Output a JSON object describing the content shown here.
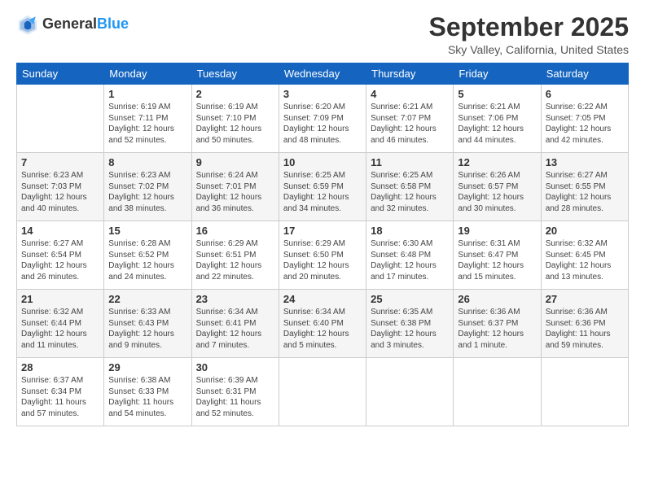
{
  "header": {
    "logo_general": "General",
    "logo_blue": "Blue",
    "title": "September 2025",
    "subtitle": "Sky Valley, California, United States"
  },
  "days_of_week": [
    "Sunday",
    "Monday",
    "Tuesday",
    "Wednesday",
    "Thursday",
    "Friday",
    "Saturday"
  ],
  "weeks": [
    [
      {
        "day": "",
        "info": ""
      },
      {
        "day": "1",
        "info": "Sunrise: 6:19 AM\nSunset: 7:11 PM\nDaylight: 12 hours\nand 52 minutes."
      },
      {
        "day": "2",
        "info": "Sunrise: 6:19 AM\nSunset: 7:10 PM\nDaylight: 12 hours\nand 50 minutes."
      },
      {
        "day": "3",
        "info": "Sunrise: 6:20 AM\nSunset: 7:09 PM\nDaylight: 12 hours\nand 48 minutes."
      },
      {
        "day": "4",
        "info": "Sunrise: 6:21 AM\nSunset: 7:07 PM\nDaylight: 12 hours\nand 46 minutes."
      },
      {
        "day": "5",
        "info": "Sunrise: 6:21 AM\nSunset: 7:06 PM\nDaylight: 12 hours\nand 44 minutes."
      },
      {
        "day": "6",
        "info": "Sunrise: 6:22 AM\nSunset: 7:05 PM\nDaylight: 12 hours\nand 42 minutes."
      }
    ],
    [
      {
        "day": "7",
        "info": "Sunrise: 6:23 AM\nSunset: 7:03 PM\nDaylight: 12 hours\nand 40 minutes."
      },
      {
        "day": "8",
        "info": "Sunrise: 6:23 AM\nSunset: 7:02 PM\nDaylight: 12 hours\nand 38 minutes."
      },
      {
        "day": "9",
        "info": "Sunrise: 6:24 AM\nSunset: 7:01 PM\nDaylight: 12 hours\nand 36 minutes."
      },
      {
        "day": "10",
        "info": "Sunrise: 6:25 AM\nSunset: 6:59 PM\nDaylight: 12 hours\nand 34 minutes."
      },
      {
        "day": "11",
        "info": "Sunrise: 6:25 AM\nSunset: 6:58 PM\nDaylight: 12 hours\nand 32 minutes."
      },
      {
        "day": "12",
        "info": "Sunrise: 6:26 AM\nSunset: 6:57 PM\nDaylight: 12 hours\nand 30 minutes."
      },
      {
        "day": "13",
        "info": "Sunrise: 6:27 AM\nSunset: 6:55 PM\nDaylight: 12 hours\nand 28 minutes."
      }
    ],
    [
      {
        "day": "14",
        "info": "Sunrise: 6:27 AM\nSunset: 6:54 PM\nDaylight: 12 hours\nand 26 minutes."
      },
      {
        "day": "15",
        "info": "Sunrise: 6:28 AM\nSunset: 6:52 PM\nDaylight: 12 hours\nand 24 minutes."
      },
      {
        "day": "16",
        "info": "Sunrise: 6:29 AM\nSunset: 6:51 PM\nDaylight: 12 hours\nand 22 minutes."
      },
      {
        "day": "17",
        "info": "Sunrise: 6:29 AM\nSunset: 6:50 PM\nDaylight: 12 hours\nand 20 minutes."
      },
      {
        "day": "18",
        "info": "Sunrise: 6:30 AM\nSunset: 6:48 PM\nDaylight: 12 hours\nand 17 minutes."
      },
      {
        "day": "19",
        "info": "Sunrise: 6:31 AM\nSunset: 6:47 PM\nDaylight: 12 hours\nand 15 minutes."
      },
      {
        "day": "20",
        "info": "Sunrise: 6:32 AM\nSunset: 6:45 PM\nDaylight: 12 hours\nand 13 minutes."
      }
    ],
    [
      {
        "day": "21",
        "info": "Sunrise: 6:32 AM\nSunset: 6:44 PM\nDaylight: 12 hours\nand 11 minutes."
      },
      {
        "day": "22",
        "info": "Sunrise: 6:33 AM\nSunset: 6:43 PM\nDaylight: 12 hours\nand 9 minutes."
      },
      {
        "day": "23",
        "info": "Sunrise: 6:34 AM\nSunset: 6:41 PM\nDaylight: 12 hours\nand 7 minutes."
      },
      {
        "day": "24",
        "info": "Sunrise: 6:34 AM\nSunset: 6:40 PM\nDaylight: 12 hours\nand 5 minutes."
      },
      {
        "day": "25",
        "info": "Sunrise: 6:35 AM\nSunset: 6:38 PM\nDaylight: 12 hours\nand 3 minutes."
      },
      {
        "day": "26",
        "info": "Sunrise: 6:36 AM\nSunset: 6:37 PM\nDaylight: 12 hours\nand 1 minute."
      },
      {
        "day": "27",
        "info": "Sunrise: 6:36 AM\nSunset: 6:36 PM\nDaylight: 11 hours\nand 59 minutes."
      }
    ],
    [
      {
        "day": "28",
        "info": "Sunrise: 6:37 AM\nSunset: 6:34 PM\nDaylight: 11 hours\nand 57 minutes."
      },
      {
        "day": "29",
        "info": "Sunrise: 6:38 AM\nSunset: 6:33 PM\nDaylight: 11 hours\nand 54 minutes."
      },
      {
        "day": "30",
        "info": "Sunrise: 6:39 AM\nSunset: 6:31 PM\nDaylight: 11 hours\nand 52 minutes."
      },
      {
        "day": "",
        "info": ""
      },
      {
        "day": "",
        "info": ""
      },
      {
        "day": "",
        "info": ""
      },
      {
        "day": "",
        "info": ""
      }
    ]
  ]
}
